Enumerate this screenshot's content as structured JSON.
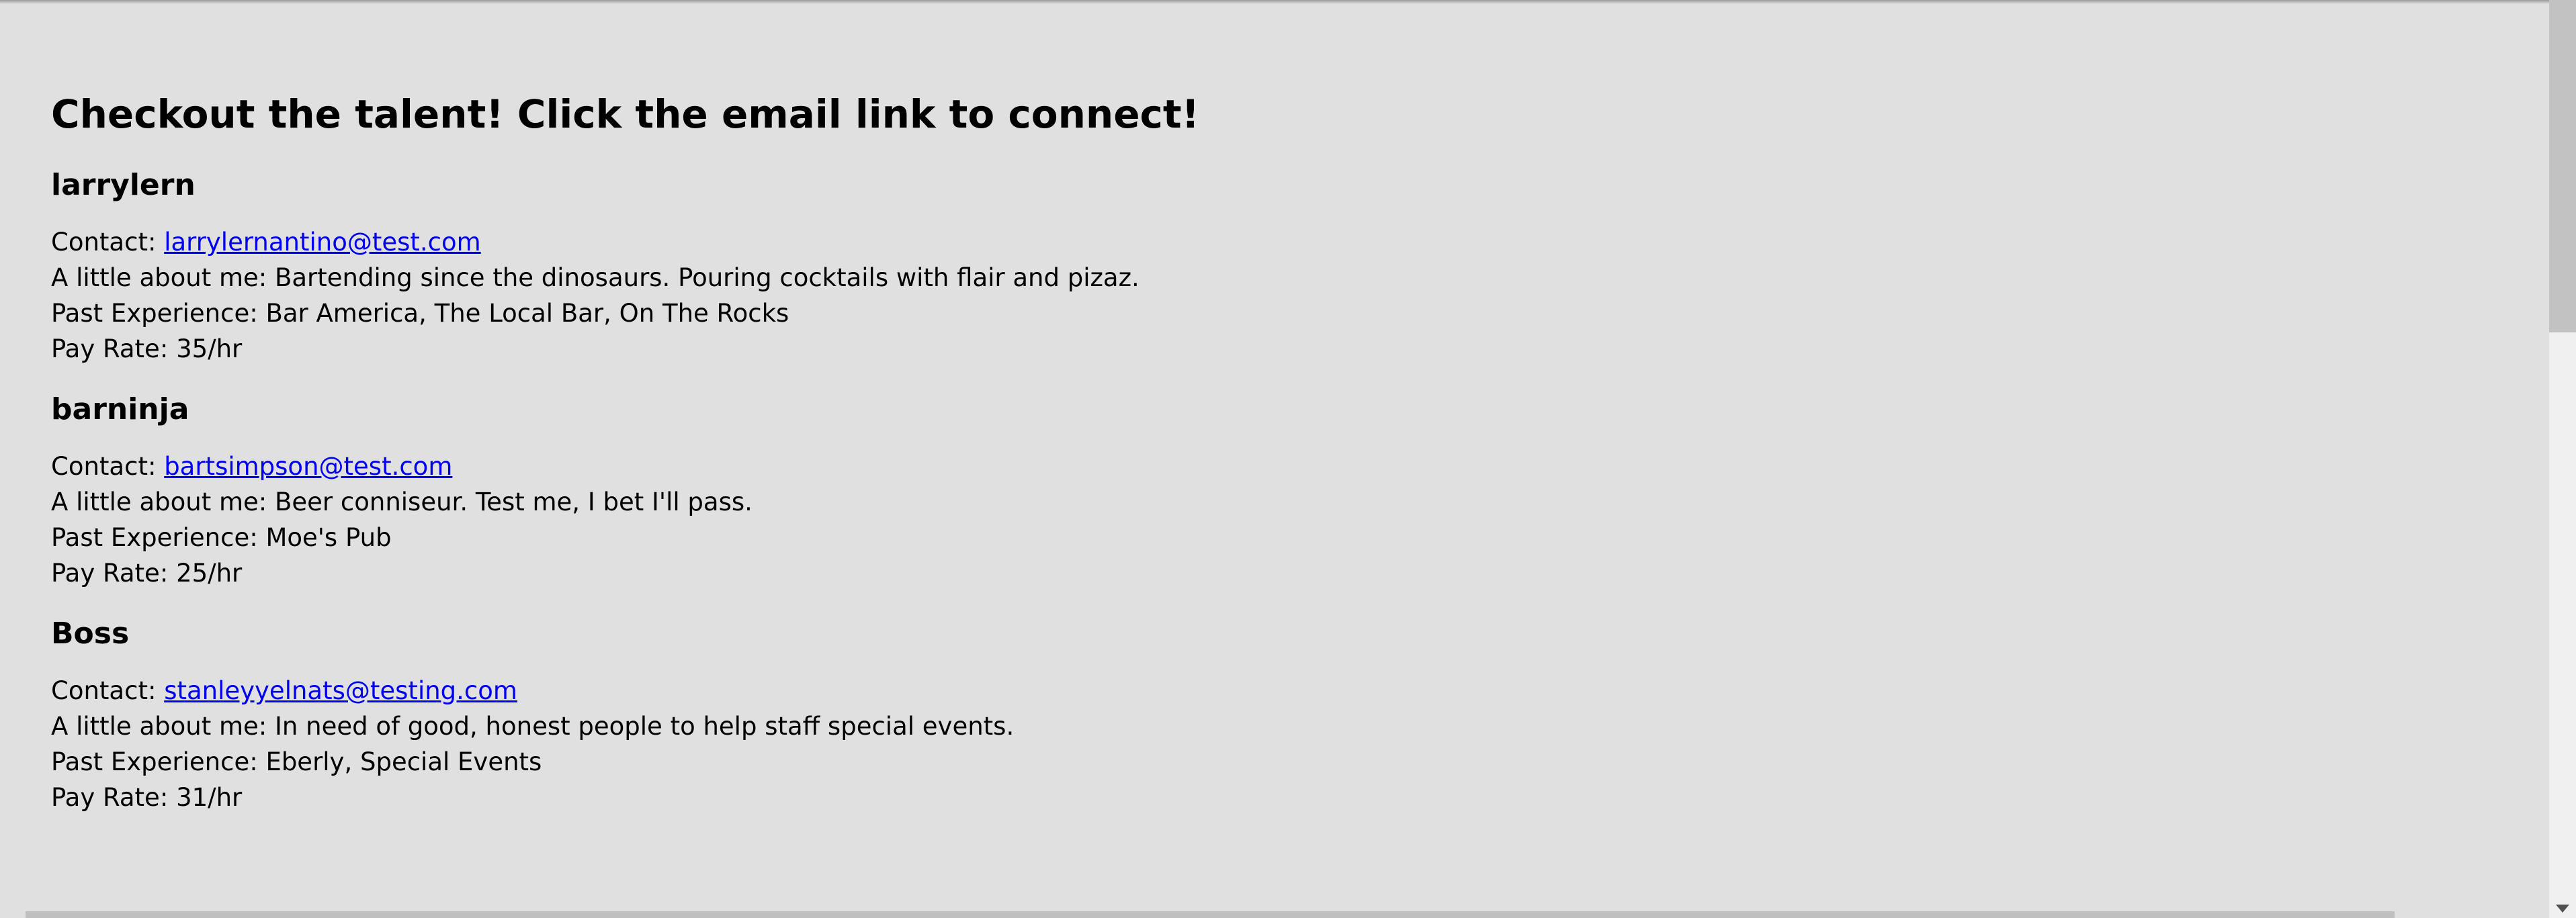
{
  "page": {
    "title": "Checkout the talent! Click the email link to connect!"
  },
  "labels": {
    "contact": "Contact: ",
    "about": "A little about me: ",
    "experience": "Past Experience: ",
    "pay": "Pay Rate: "
  },
  "profiles": [
    {
      "name": "larrylern",
      "email": "larrylernantino@test.com",
      "about": "Bartending since the dinosaurs. Pouring cocktails with flair and pizaz.",
      "experience": "Bar America, The Local Bar, On The Rocks",
      "pay": "35/hr"
    },
    {
      "name": "barninja",
      "email": "bartsimpson@test.com",
      "about": "Beer conniseur. Test me, I bet I'll pass.",
      "experience": "Moe's Pub",
      "pay": "25/hr"
    },
    {
      "name": "Boss",
      "email": "stanleyyelnats@testing.com",
      "about": "In need of good, honest people to help staff special events.",
      "experience": "Eberly, Special Events",
      "pay": "31/hr"
    }
  ],
  "colors": {
    "background": "#e0e0e0",
    "link": "#0000ee"
  }
}
